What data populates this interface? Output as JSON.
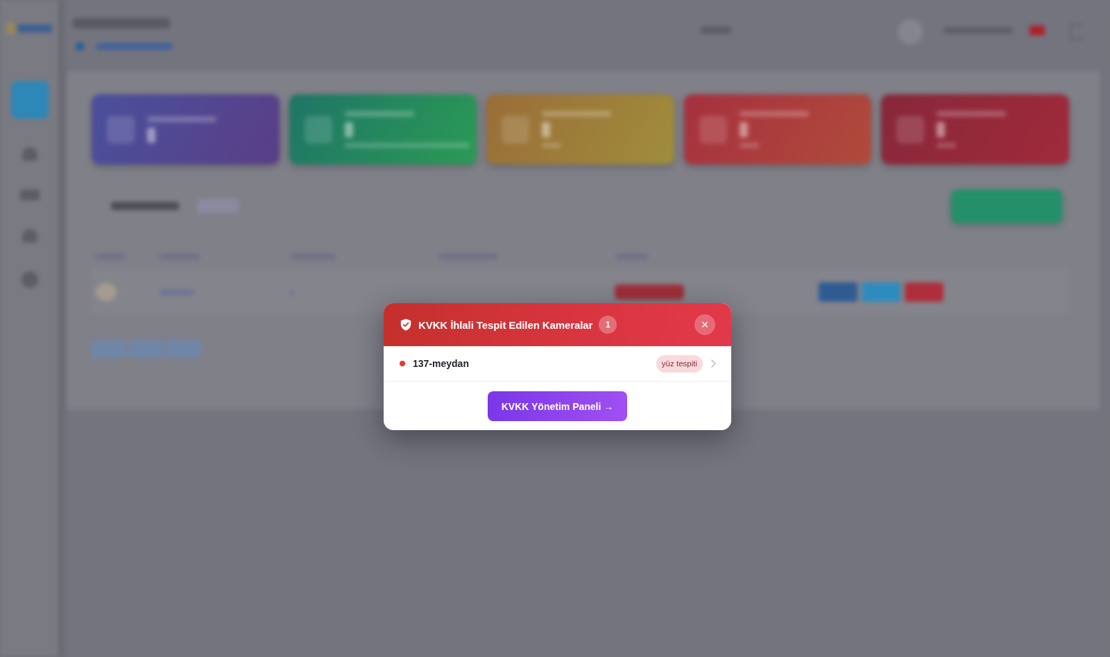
{
  "modal": {
    "title": "KVKK İhlali Tespit Edilen Kameralar",
    "count": "1",
    "close": "×",
    "items": [
      {
        "name": "137-meydan",
        "tag": "yüz tespiti",
        "color": "#e53935"
      }
    ],
    "action": "KVKK Yönetim Paneli →"
  }
}
